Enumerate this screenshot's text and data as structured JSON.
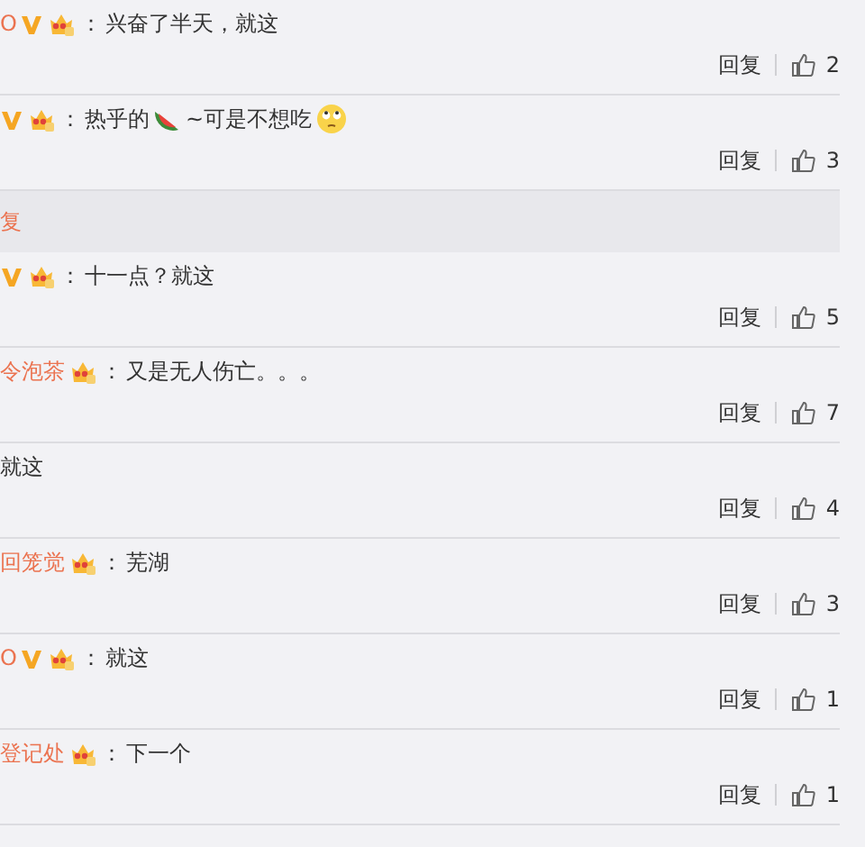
{
  "items": [
    {
      "kind": "comment",
      "name": "O",
      "verified": true,
      "crown": true,
      "colon": "：",
      "segments": [
        {
          "kind": "text",
          "text": "兴奋了半天，就这"
        }
      ],
      "reply": "回复",
      "likes": "2"
    },
    {
      "kind": "comment",
      "verified": true,
      "crown": true,
      "colon": "：",
      "segments": [
        {
          "kind": "text",
          "text": "热乎的"
        },
        {
          "kind": "watermelon"
        },
        {
          "kind": "text",
          "text": "~可是不想吃"
        },
        {
          "kind": "eyeroll"
        }
      ],
      "reply": "回复",
      "likes": "3"
    },
    {
      "kind": "reply_bar",
      "text": "复"
    },
    {
      "kind": "comment",
      "verified": true,
      "crown": true,
      "colon": "：",
      "segments": [
        {
          "kind": "text",
          "text": "十一点？就这"
        }
      ],
      "reply": "回复",
      "likes": "5"
    },
    {
      "kind": "comment",
      "name": "令泡茶",
      "verified": false,
      "crown": true,
      "colon": "：",
      "segments": [
        {
          "kind": "text",
          "text": "又是无人伤亡。。。"
        }
      ],
      "reply": "回复",
      "likes": "7"
    },
    {
      "kind": "comment",
      "verified": false,
      "crown": false,
      "segments": [
        {
          "kind": "text",
          "text": "就这"
        }
      ],
      "reply": "回复",
      "likes": "4"
    },
    {
      "kind": "comment",
      "name": "回笼觉",
      "verified": false,
      "crown": true,
      "colon": "：",
      "segments": [
        {
          "kind": "text",
          "text": "芜湖"
        }
      ],
      "reply": "回复",
      "likes": "3"
    },
    {
      "kind": "comment",
      "name": "O",
      "verified": true,
      "crown": true,
      "colon": "：",
      "segments": [
        {
          "kind": "text",
          "text": "就这"
        }
      ],
      "reply": "回复",
      "likes": "1"
    },
    {
      "kind": "comment",
      "name": "登记处",
      "verified": false,
      "crown": true,
      "colon": "：",
      "segments": [
        {
          "kind": "text",
          "text": "下一个"
        }
      ],
      "reply": "回复",
      "likes": "1"
    }
  ]
}
